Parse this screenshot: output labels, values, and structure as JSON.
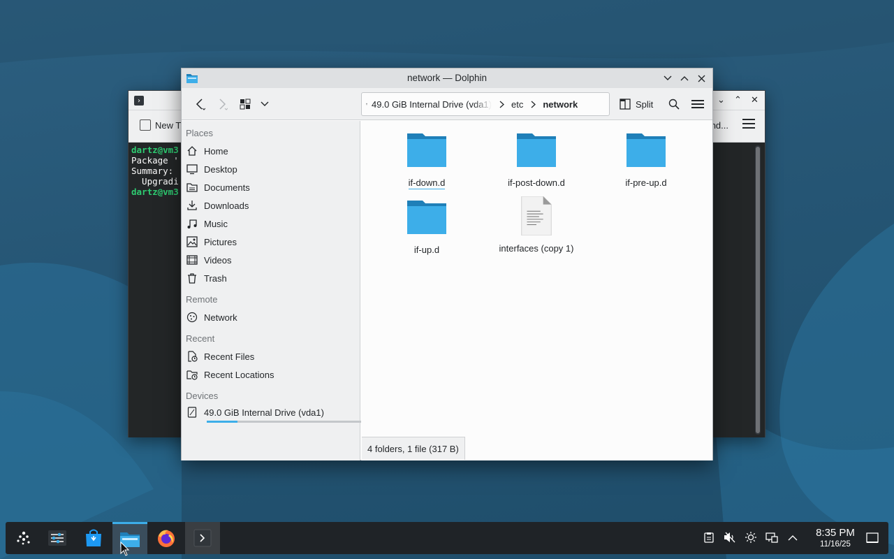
{
  "terminal": {
    "new_tab_label": "New T",
    "toolbar_right_text": "nd...",
    "lines": [
      {
        "text": "dartz@vm3",
        "style": "prompt"
      },
      {
        "text": "Package '",
        "style": "normal"
      },
      {
        "text": "Summary:",
        "style": "normal"
      },
      {
        "text": "  Upgradi",
        "style": "normal"
      },
      {
        "text": "dartz@vm3",
        "style": "prompt"
      }
    ]
  },
  "dolphin": {
    "title": "network — Dolphin",
    "toolbar": {
      "back_icon": "back-arrow-icon",
      "forward_icon": "forward-arrow-icon",
      "view_mode_icon": "icons-view-icon",
      "split_label": "Split"
    },
    "breadcrumb": {
      "drive_label": "49.0 GiB Internal Drive (vda1)",
      "items": [
        "etc"
      ],
      "current": "network"
    },
    "sidebar": {
      "places_header": "Places",
      "places": [
        {
          "label": "Home",
          "icon": "home-icon"
        },
        {
          "label": "Desktop",
          "icon": "desktop-icon"
        },
        {
          "label": "Documents",
          "icon": "documents-icon"
        },
        {
          "label": "Downloads",
          "icon": "downloads-icon"
        },
        {
          "label": "Music",
          "icon": "music-icon"
        },
        {
          "label": "Pictures",
          "icon": "pictures-icon"
        },
        {
          "label": "Videos",
          "icon": "videos-icon"
        },
        {
          "label": "Trash",
          "icon": "trash-icon"
        }
      ],
      "remote_header": "Remote",
      "remote": [
        {
          "label": "Network",
          "icon": "network-icon"
        }
      ],
      "recent_header": "Recent",
      "recent": [
        {
          "label": "Recent Files",
          "icon": "recent-files-icon"
        },
        {
          "label": "Recent Locations",
          "icon": "recent-locations-icon"
        }
      ],
      "devices_header": "Devices",
      "devices": [
        {
          "label": "49.0 GiB Internal Drive (vda1)",
          "icon": "drive-icon",
          "usage_fraction": 0.2
        }
      ]
    },
    "files": [
      {
        "name": "if-down.d",
        "type": "folder"
      },
      {
        "name": "if-post-down.d",
        "type": "folder"
      },
      {
        "name": "if-pre-up.d",
        "type": "folder"
      },
      {
        "name": "if-up.d",
        "type": "folder"
      },
      {
        "name": "interfaces (copy 1)",
        "type": "text-file"
      }
    ],
    "status": "4 folders, 1 file (317 B)"
  },
  "taskbar": {
    "clock_time": "8:35 PM",
    "clock_date": "11/16/25",
    "tasks": [
      "app-launcher-icon",
      "system-settings-icon",
      "discover-icon",
      "dolphin-icon",
      "firefox-icon",
      "konsole-icon"
    ]
  },
  "colors": {
    "accent": "#3daee9",
    "folder": "#3daee9",
    "folder_tab": "#1f7fb8",
    "terminal_prompt": "#2ecc71"
  }
}
